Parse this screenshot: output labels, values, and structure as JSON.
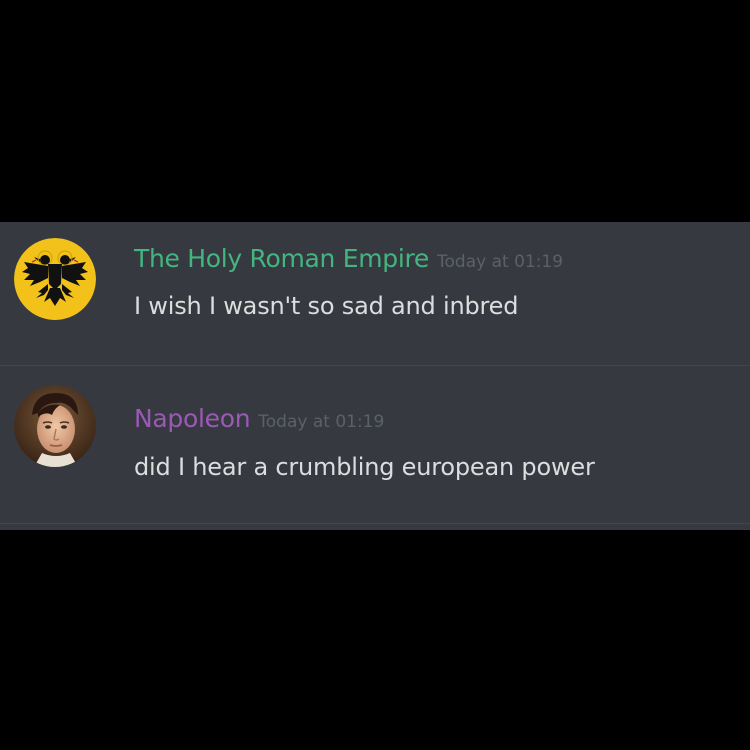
{
  "messages": [
    {
      "username": "The Holy Roman Empire",
      "username_color": "#43b581",
      "timestamp": "Today at 01:19",
      "text": "I wish I wasn't so sad and inbred",
      "avatar_icon": "double-headed-eagle-icon"
    },
    {
      "username": "Napoleon",
      "username_color": "#9b59b6",
      "timestamp": "Today at 01:19",
      "text": "did I hear a crumbling european power",
      "avatar_icon": "napoleon-portrait"
    }
  ],
  "colors": {
    "background": "#000000",
    "chat_background": "#36393f",
    "timestamp": "#5c6067",
    "message_text": "#dcddde",
    "eagle_field": "#f2c21a"
  }
}
